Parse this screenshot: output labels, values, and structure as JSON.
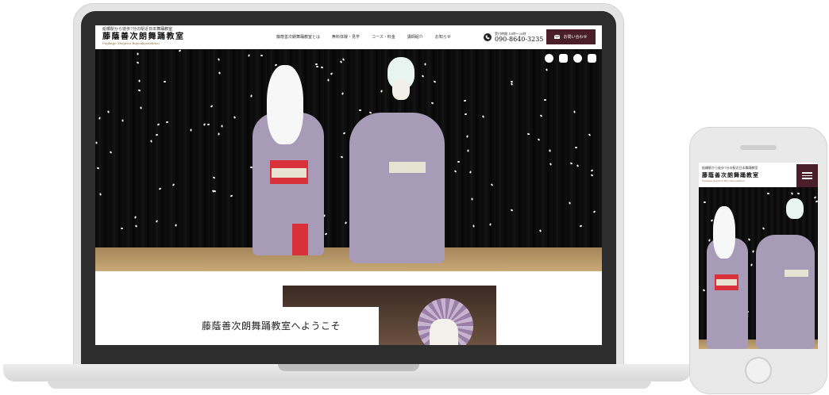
{
  "site": {
    "tagline": "船橋駅から徒歩7分の駅近日本舞踊教室",
    "title": "藤蔭善次朗舞踊教室",
    "roman": "Fujikage Zenjirou Buyoukyoushitsu"
  },
  "nav": {
    "items": [
      {
        "label": "藤蔭善次朗舞踊教室とは"
      },
      {
        "label": "無料体験・見学"
      },
      {
        "label": "コース・料金"
      },
      {
        "label": "講師紹介"
      },
      {
        "label": "お知らせ"
      }
    ]
  },
  "contact": {
    "hours": "受付時間 10時〜20時",
    "phone": "090-8640-3235",
    "button_label": "お問い合わせ"
  },
  "social": {
    "icons": [
      "twitter-icon",
      "instagram-icon",
      "facebook-icon",
      "youtube-icon"
    ]
  },
  "welcome": {
    "title": "藤蔭善次朗舞踊教室へようこそ"
  },
  "mobile": {
    "tagline": "船橋駅から徒歩7分の駅近日本舞踊教室",
    "title": "藤蔭善次朗舞踊教室",
    "roman": "Fujikage Zenjirou Buyoukyoushitsu"
  },
  "colors": {
    "brand": "#4a1f2a",
    "accent_gold": "#8a6d3b",
    "robe": "#a89bb7"
  }
}
